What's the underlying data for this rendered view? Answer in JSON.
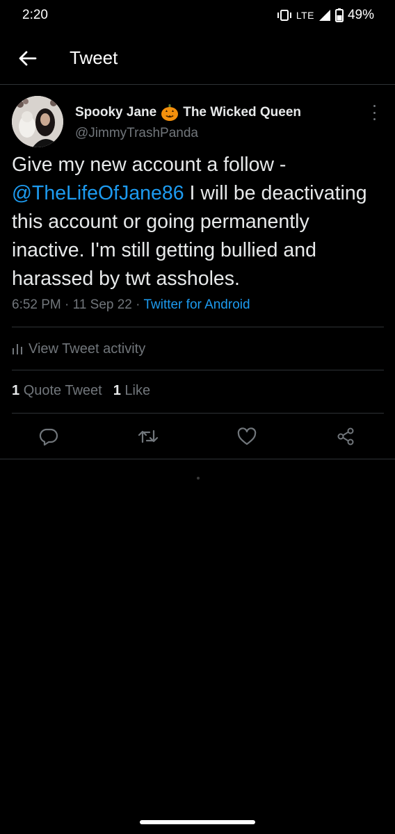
{
  "status_bar": {
    "time": "2:20",
    "network": "LTE",
    "battery": "49%"
  },
  "header": {
    "title": "Tweet"
  },
  "tweet": {
    "author_name": "Spooky Jane",
    "author_title": "The Wicked Queen",
    "author_emoji": "jack-o-lantern",
    "handle": "@JimmyTrashPanda",
    "text_part1": "Give my new account a follow - ",
    "mention": "@TheLifeOfJane86",
    "text_part2": " I will be deactivating this account or going permanently inactive. I'm still getting bullied and harassed by twt assholes.",
    "time": "6:52 PM",
    "date": "11 Sep 22",
    "source": "Twitter for Android"
  },
  "activity": {
    "label": "View Tweet activity"
  },
  "stats": {
    "quote_count": "1",
    "quote_label": "Quote Tweet",
    "like_count": "1",
    "like_label": "Like"
  },
  "actions": [
    "reply-icon",
    "retweet-icon",
    "like-icon",
    "share-icon"
  ],
  "colors": {
    "background": "#000000",
    "accent": "#1d9bf0",
    "secondary_text": "#71767b",
    "divider": "#2f3336"
  }
}
